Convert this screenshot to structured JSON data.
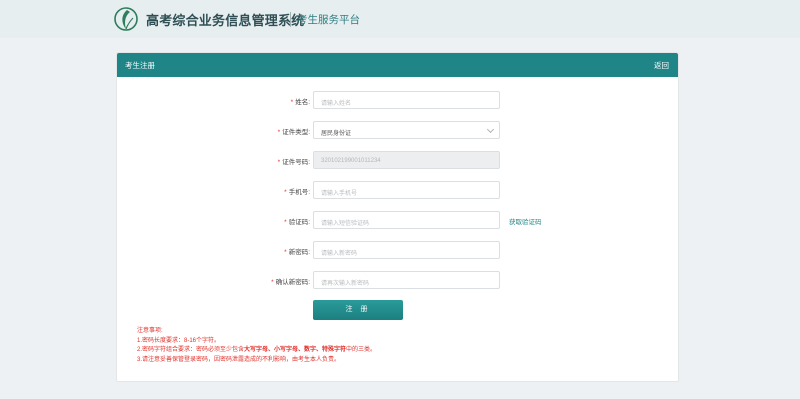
{
  "header": {
    "system_title": "高考综合业务信息管理系统",
    "platform": "考生服务平台"
  },
  "panel": {
    "title": "考生注册",
    "back": "返回"
  },
  "form": {
    "fields": [
      {
        "label": "姓名:",
        "placeholder": "请输入姓名"
      },
      {
        "label": "证件类型:",
        "value": "居民身份证"
      },
      {
        "label": "证件号码:",
        "placeholder": "320102199001011234"
      },
      {
        "label": "手机号:",
        "placeholder": "请输入手机号"
      },
      {
        "label": "验证码:",
        "placeholder": "请输入短信验证码"
      },
      {
        "label": "新密码:",
        "placeholder": "请输入新密码"
      },
      {
        "label": "确认新密码:",
        "placeholder": "请再次输入新密码"
      }
    ],
    "get_code": "获取验证码",
    "submit": "注 册"
  },
  "notes": {
    "title": "注意事项:",
    "line1": "1.密码长度要求：8-16个字符。",
    "line2_prefix": "2.密码字符组合要求：密码必须至少包含",
    "line2_bold": "大写字母、小写字母、数字、特殊字符",
    "line2_suffix": "中的三类。",
    "line3": "3.请注意妥善保管登录密码，因密码泄露造成的不利影响，由考生本人负责。"
  }
}
